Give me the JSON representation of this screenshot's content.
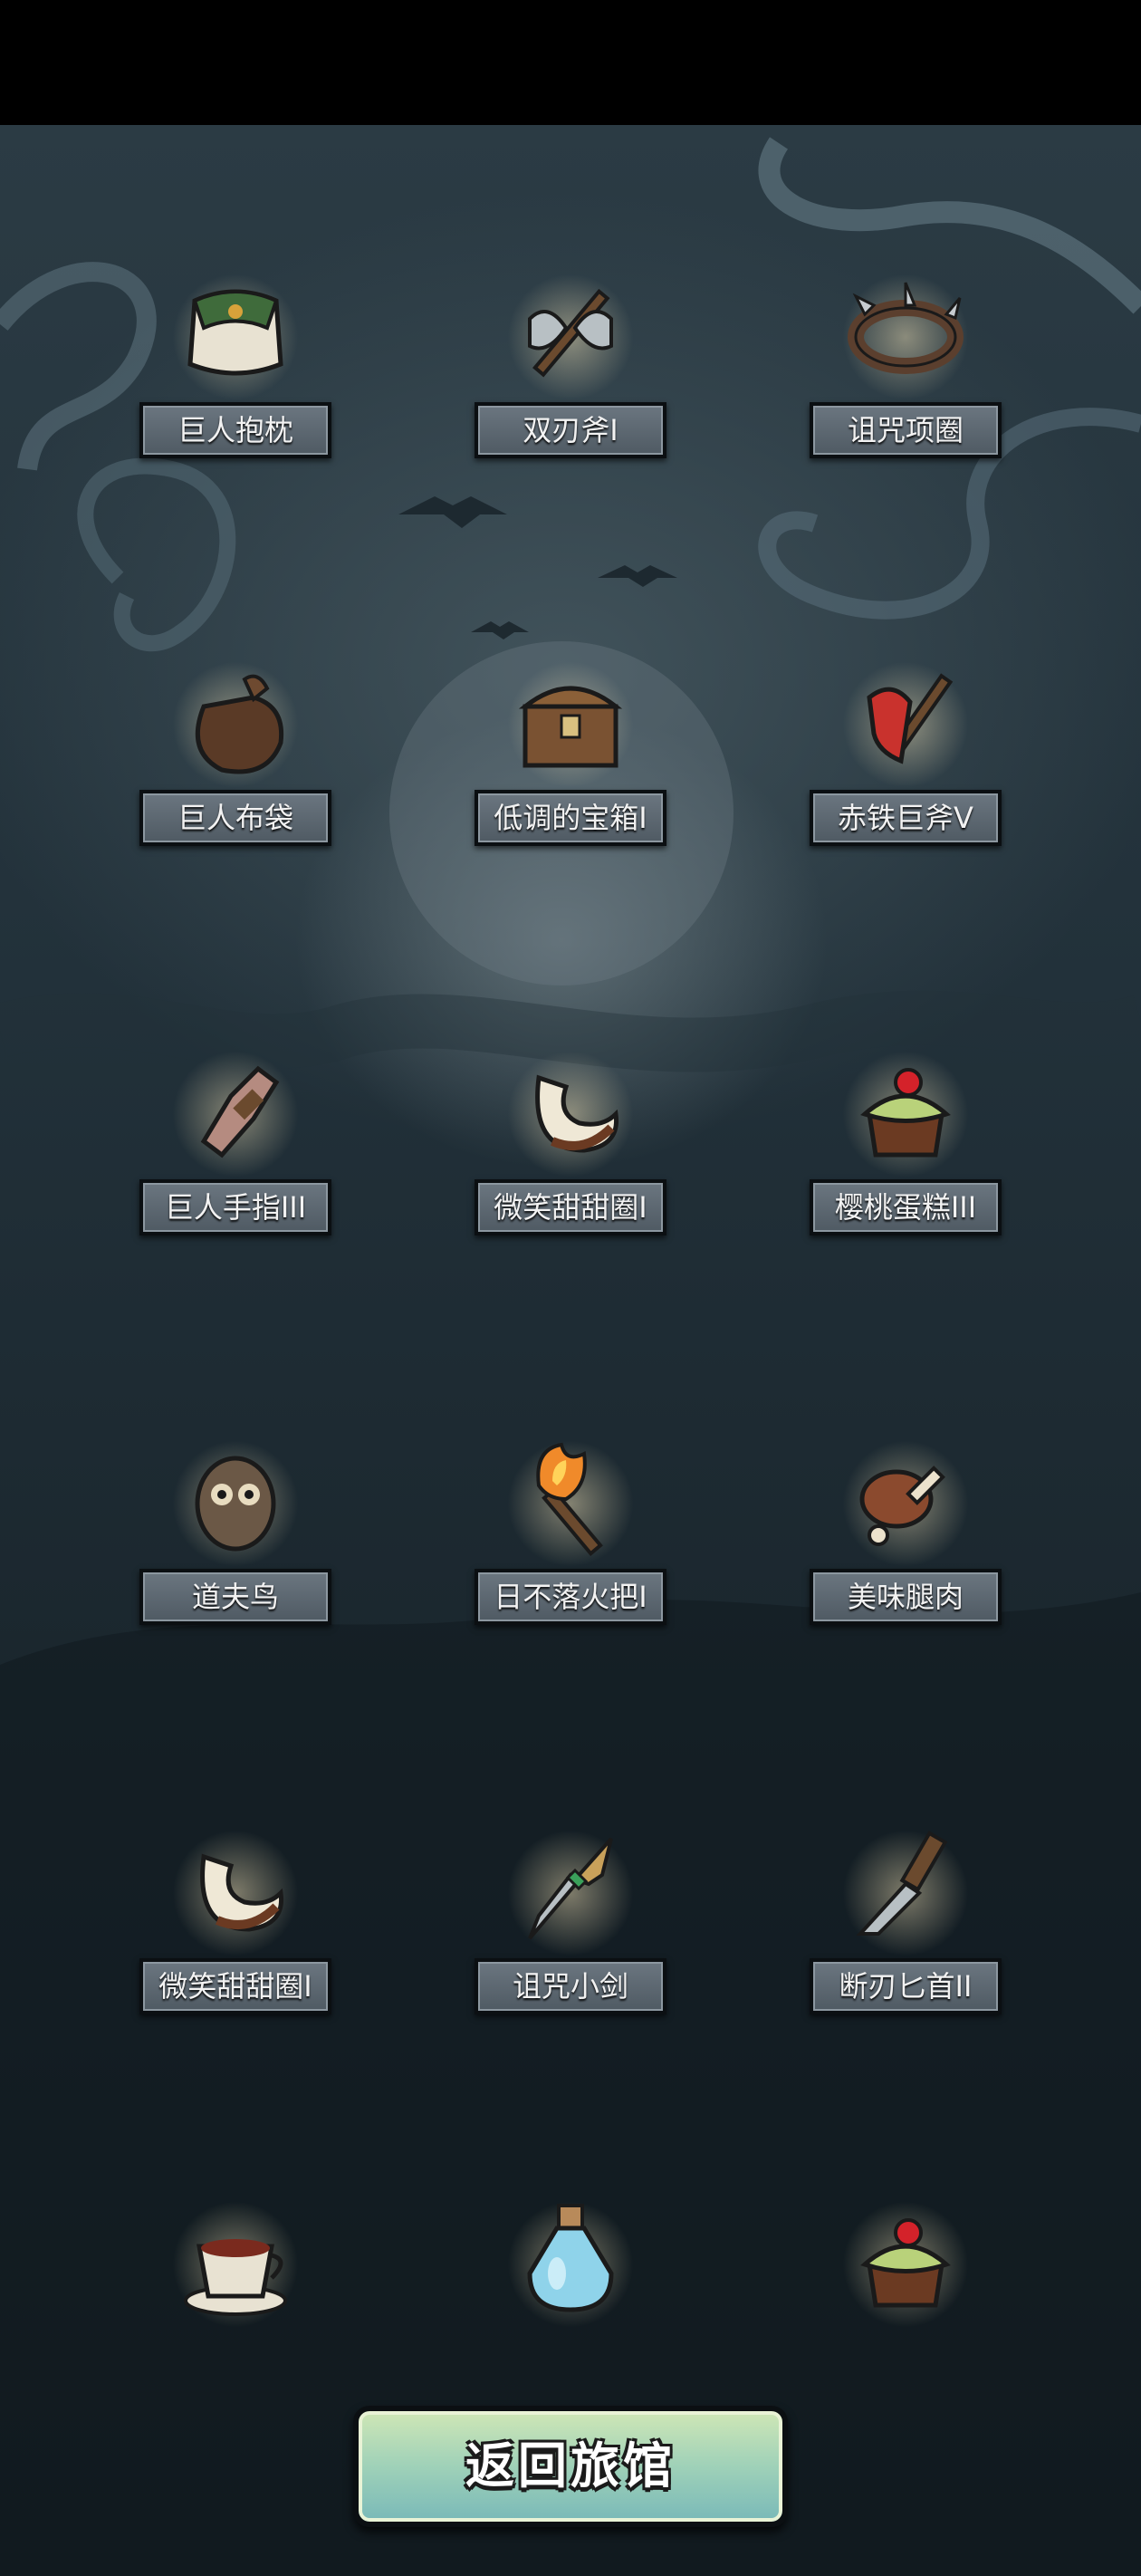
{
  "items": [
    {
      "name": "巨人抱枕",
      "icon": "pillow-icon"
    },
    {
      "name": "双刃斧I",
      "icon": "double-axe-icon"
    },
    {
      "name": "诅咒项圈",
      "icon": "spiked-collar-icon"
    },
    {
      "name": "巨人布袋",
      "icon": "sack-icon"
    },
    {
      "name": "低调的宝箱I",
      "icon": "treasure-chest-icon"
    },
    {
      "name": "赤铁巨斧V",
      "icon": "red-axe-icon"
    },
    {
      "name": "巨人手指III",
      "icon": "giant-finger-icon"
    },
    {
      "name": "微笑甜甜圈I",
      "icon": "donut-icon"
    },
    {
      "name": "樱桃蛋糕III",
      "icon": "cherry-cake-icon"
    },
    {
      "name": "道夫鸟",
      "icon": "owl-icon"
    },
    {
      "name": "日不落火把I",
      "icon": "torch-icon"
    },
    {
      "name": "美味腿肉",
      "icon": "drumstick-icon"
    },
    {
      "name": "微笑甜甜圈I",
      "icon": "donut-icon"
    },
    {
      "name": "诅咒小剑",
      "icon": "cursed-dagger-icon"
    },
    {
      "name": "断刃匕首II",
      "icon": "broken-dagger-icon"
    },
    {
      "name": "",
      "icon": "tea-cup-icon"
    },
    {
      "name": "",
      "icon": "potion-bottle-icon"
    },
    {
      "name": "",
      "icon": "cherry-cake-icon"
    }
  ],
  "return_button": {
    "label": "返回旅馆"
  }
}
